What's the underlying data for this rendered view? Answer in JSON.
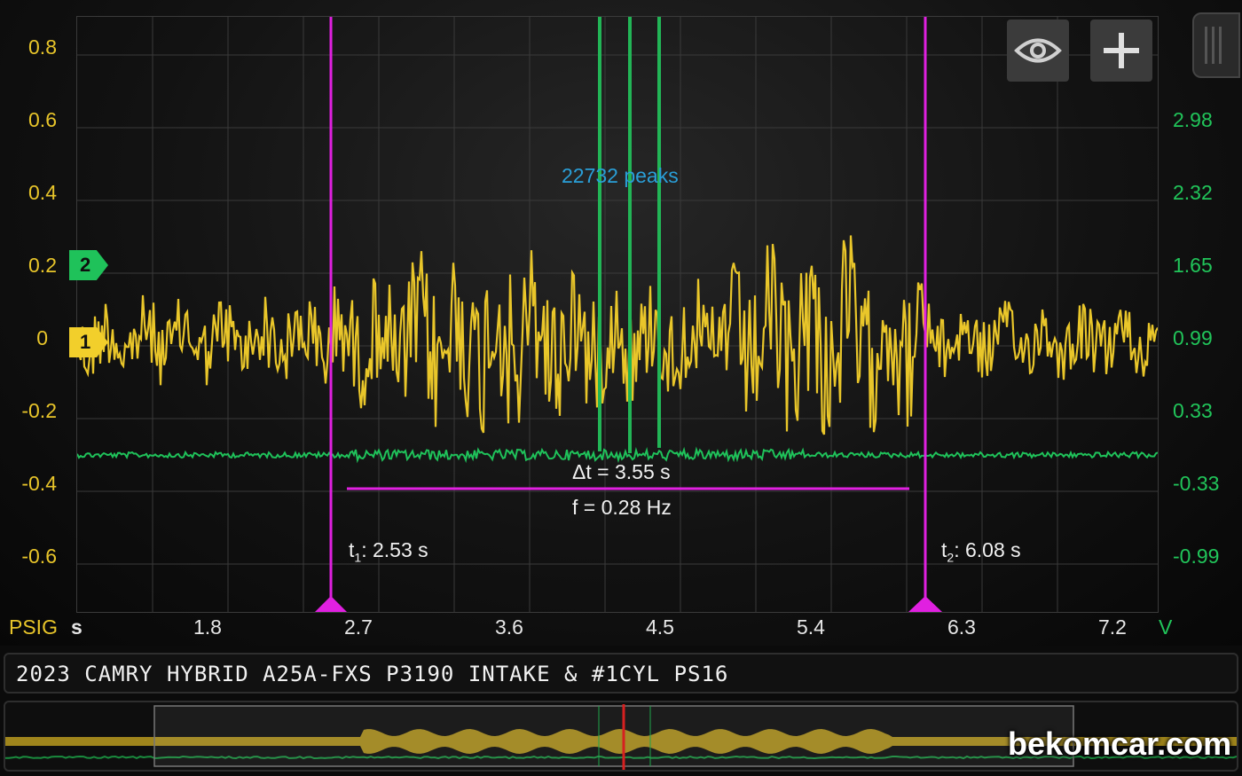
{
  "y_left": {
    "unit": "PSIG",
    "ticks": [
      "0.8",
      "0.6",
      "0.4",
      "0.2",
      "0",
      "-0.2",
      "-0.4",
      "-0.6"
    ],
    "color": "#e8c52a"
  },
  "y_right": {
    "unit": "V",
    "ticks": [
      "2.98",
      "2.32",
      "1.65",
      "0.99",
      "0.33",
      "-0.33",
      "-0.99"
    ],
    "color": "#21c55a"
  },
  "x_axis": {
    "unit": "s",
    "ticks": [
      "1.8",
      "2.7",
      "3.6",
      "4.5",
      "5.4",
      "6.3",
      "7.2"
    ]
  },
  "channels": {
    "ch1": {
      "label": "1",
      "color": "#f2cf2b"
    },
    "ch2": {
      "label": "2",
      "color": "#1fc25a"
    }
  },
  "peaks_label": "22732 peaks",
  "measurement": {
    "delta_t": "Δt = 3.55 s",
    "frequency": "f = 0.28 Hz"
  },
  "cursors": {
    "t1": {
      "label": "t",
      "sub": "1",
      "value": ": 2.53 s"
    },
    "t2": {
      "label": "t",
      "sub": "2",
      "value": ": 6.08 s"
    },
    "color": "#e020e0"
  },
  "title": "2023 CAMRY HYBRID A25A-FXS P3190 INTAKE & #1CYL PS16",
  "watermark": "bekomcar.com",
  "buttons": {
    "view": "eye-icon",
    "add": "plus-icon"
  }
}
